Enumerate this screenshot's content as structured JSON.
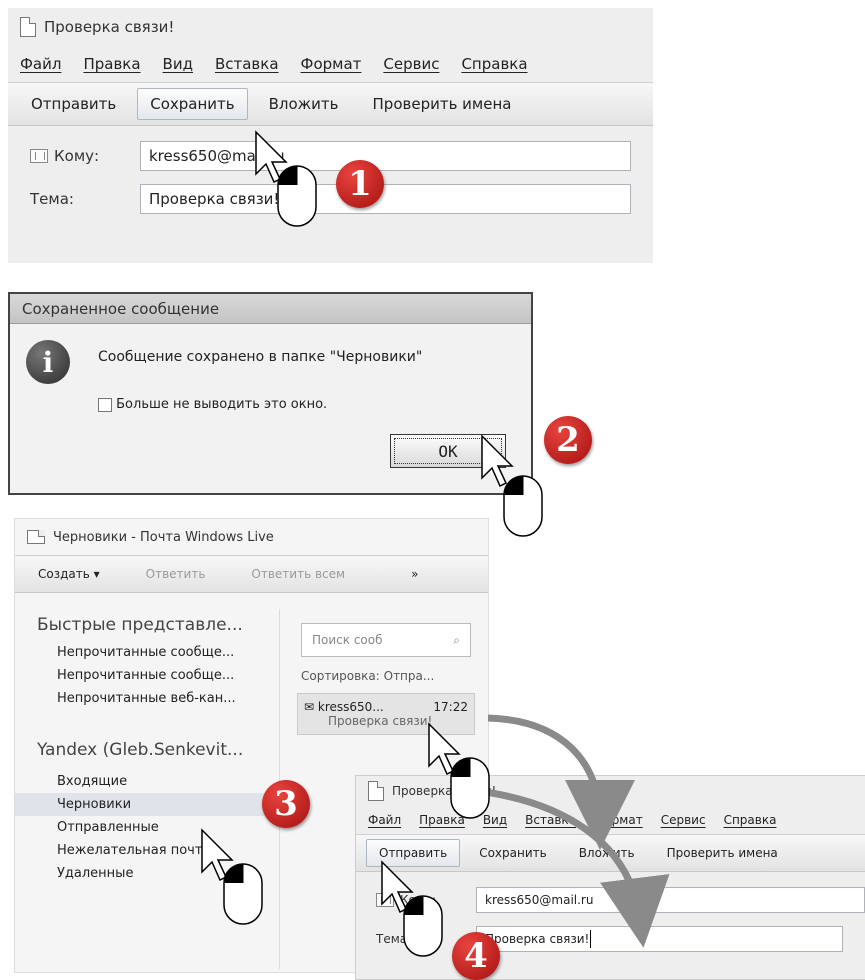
{
  "win1": {
    "title": "Проверка связи!",
    "menu": [
      "Файл",
      "Правка",
      "Вид",
      "Вставка",
      "Формат",
      "Сервис",
      "Справка"
    ],
    "toolbar": [
      "Отправить",
      "Сохранить",
      "Вложить",
      "Проверить имена"
    ],
    "to_label": "Кому:",
    "to_value": "kress650@mail.ru",
    "subject_label": "Тема:",
    "subject_value": "Проверка связи!"
  },
  "dialog": {
    "title": "Сохраненное сообщение",
    "message": "Сообщение сохранено в папке \"Черновики\"",
    "checkbox_label": "Больше не выводить это окно.",
    "ok_label": "OK"
  },
  "wl": {
    "title": "Черновики - Почта Windows Live",
    "toolbar": [
      "Создать ▾",
      "Ответить",
      "Ответить всем",
      "»"
    ],
    "quick_views_title": "Быстрые представле...",
    "quick_views": [
      "Непрочитанные сообще...",
      "Непрочитанные сообще...",
      "Непрочитанные веб-кан..."
    ],
    "account": "Yandex (Gleb.Senkevit...",
    "folders": [
      "Входящие",
      "Черновики",
      "Отправленные",
      "Нежелательная почта",
      "Удаленные"
    ],
    "search_placeholder": "Поиск сооб",
    "sort_label": "Сортировка: Отпра...",
    "message_from": "kress650...",
    "message_time": "17:22",
    "message_subject": "Проверка связи!"
  },
  "win2": {
    "title": "Проверка связи!",
    "menu": [
      "Файл",
      "Правка",
      "Вид",
      "Вставка",
      "Формат",
      "Сервис",
      "Справка"
    ],
    "toolbar": [
      "Отправить",
      "Сохранить",
      "Вложить",
      "Проверить имена"
    ],
    "to_label": "Кому:",
    "to_value": "kress650@mail.ru",
    "subject_label": "Тема:",
    "subject_value": "Проверка связи!"
  },
  "badges": [
    "1",
    "2",
    "3",
    "4"
  ],
  "colors": {
    "badge": "#c4161c",
    "arrow": "#8a8a8a"
  }
}
